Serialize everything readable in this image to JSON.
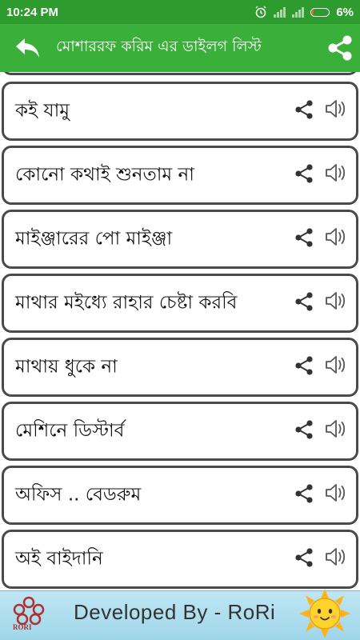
{
  "status_bar": {
    "time": "10:24 PM",
    "battery_percent": "6%"
  },
  "app_bar": {
    "title": "মোশাররফ করিম এর ডাইলগ লিস্ট"
  },
  "dialogs": [
    {
      "text": "কই যামু"
    },
    {
      "text": "কোনো কথাই শুনতাম না"
    },
    {
      "text": "মাইঞ্জারের পো মাইঞ্জা"
    },
    {
      "text": "মাথার মইধ্যে রাহার চেষ্টা করবি"
    },
    {
      "text": "মাথায় ধুকে না"
    },
    {
      "text": "মেশিনে ডিস্টার্ব"
    },
    {
      "text": "অফিস .. বেডরুম"
    },
    {
      "text": "অই বাইদানি"
    }
  ],
  "banner": {
    "text": "Developed By - RoRi",
    "logo_text": "RORI"
  },
  "icons": {
    "back": "back-arrow-icon",
    "share": "share-icon",
    "sound": "speaker-icon"
  },
  "colors": {
    "status_bar": "#2e9b2e",
    "app_bar": "#3ab03a",
    "card_border": "#4a4a4a",
    "banner": "#aedcec"
  }
}
